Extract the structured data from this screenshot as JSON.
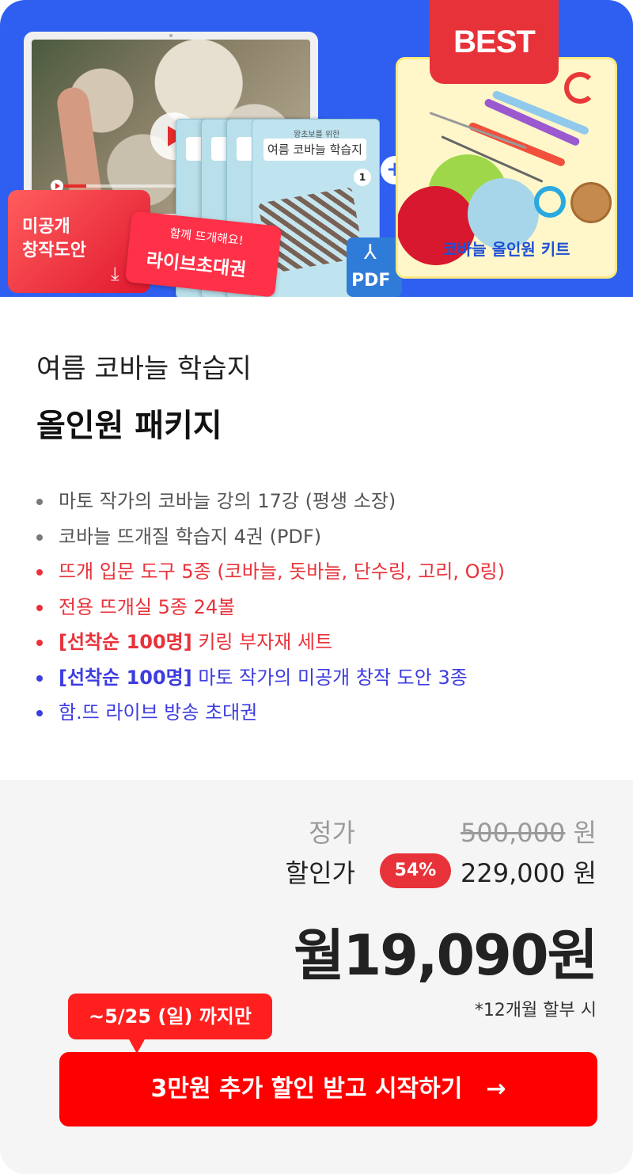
{
  "hero": {
    "best_badge": "BEST",
    "ticket_pattern": "미공개\n창작도안",
    "ticket_live_top": "함께 뜨개해요!",
    "ticket_live_main": "라이브초대권",
    "book_subtitle": "왕초보를 위한",
    "book_title": "여름 코바늘 학습지",
    "book_number": "1",
    "pdf_label": "PDF",
    "plus": "+",
    "kit_label": "코바늘 올인원 키트"
  },
  "product": {
    "title_line1": "여름 코바늘 학습지",
    "title_line2": "올인원 패키지"
  },
  "features": [
    {
      "strong": "",
      "text": "마토 작가의 코바늘 강의 17강 (평생 소장)",
      "color": "#555555",
      "dot": "#7a7a7a"
    },
    {
      "strong": "",
      "text": "코바늘 뜨개질 학습지 4권 (PDF)",
      "color": "#555555",
      "dot": "#7a7a7a"
    },
    {
      "strong": "",
      "text": "뜨개 입문 도구 5종 (코바늘, 돗바늘, 단수링, 고리, O링)",
      "color": "#e8323a",
      "dot": "#e8323a"
    },
    {
      "strong": "",
      "text": "전용 뜨개실 5종 24볼",
      "color": "#e8323a",
      "dot": "#e8323a"
    },
    {
      "strong": "[선착순 100명]",
      "text": " 키링 부자재 세트",
      "color": "#e8323a",
      "dot": "#e8323a"
    },
    {
      "strong": "[선착순 100명]",
      "text": " 마토 작가의 미공개 창작 도안 3종",
      "color": "#3d3de0",
      "dot": "#3d3de0"
    },
    {
      "strong": "",
      "text": "함.뜨 라이브 방송 초대권",
      "color": "#3d3de0",
      "dot": "#3d3de0"
    }
  ],
  "pricing": {
    "original_label": "정가",
    "original_value": "500,000",
    "currency": "원",
    "sale_label": "할인가",
    "discount_badge": "54%",
    "sale_value": "229,000 원",
    "monthly": "월19,090원",
    "installment_note": "*12개월 할부 시",
    "deadline": "~5/25 (일) 까지만",
    "cta_label": "3만원 추가 할인 받고 시작하기",
    "cta_arrow": "→"
  },
  "colors": {
    "hero_bg": "#2f5ff0",
    "accent_red": "#e8323a",
    "cta_red": "#ff0000",
    "blue_text": "#3d3de0",
    "price_bg": "#f5f5f5"
  }
}
